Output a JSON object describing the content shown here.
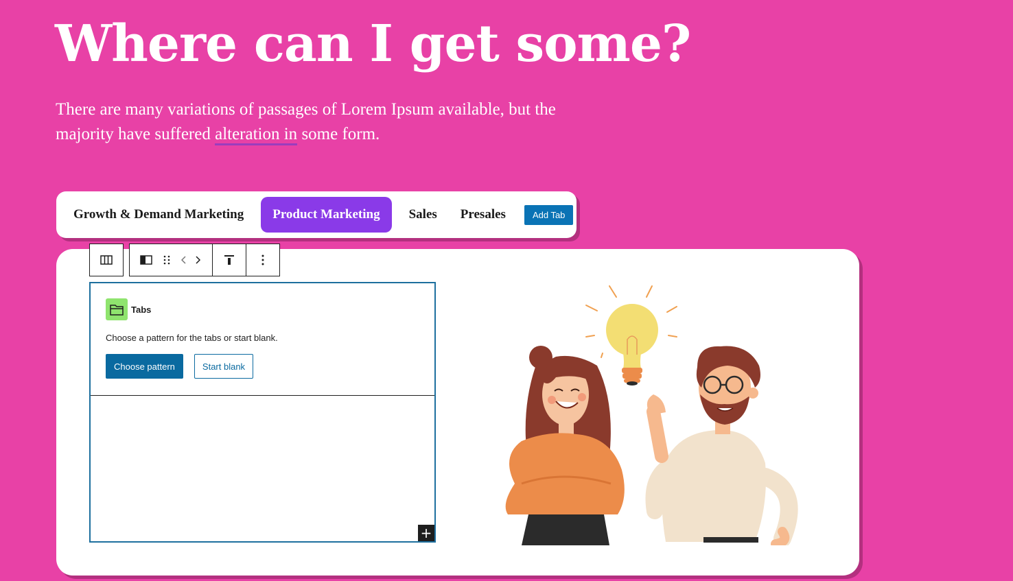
{
  "hero": {
    "title": "Where can I get some?",
    "text_before": "There are many variations of passages of Lorem Ipsum available, but the majority have suffered ",
    "text_underlined": "alteration in",
    "text_after": " some form."
  },
  "tabs": {
    "items": [
      {
        "label": "Growth & Demand Marketing"
      },
      {
        "label": "Product Marketing"
      },
      {
        "label": "Sales"
      },
      {
        "label": "Presales"
      }
    ],
    "active": "Product Marketing",
    "add_label": "Add Tab"
  },
  "placeholder": {
    "title": "Tabs",
    "description": "Choose a pattern for the tabs or start blank.",
    "primary_label": "Choose pattern",
    "secondary_label": "Start blank",
    "inserter": "+"
  },
  "toolbar": {
    "icons": [
      "columns-icon",
      "block-type-icon",
      "drag-handle-icon",
      "move-arrows-icon",
      "align-top-icon",
      "more-options-icon"
    ]
  },
  "colors": {
    "background": "#e841a6",
    "active_tab": "#8a3ae8",
    "primary_button": "#0a6aa0",
    "tabs_icon_bg": "#8fe46e"
  }
}
